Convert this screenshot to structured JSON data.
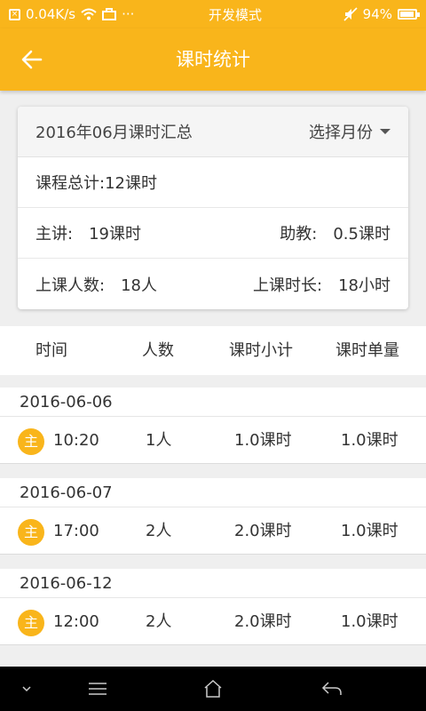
{
  "status_bar": {
    "speed": "0.04K/s",
    "mode": "开发模式",
    "battery": "94%",
    "battery_level": 0.94,
    "dots": "···"
  },
  "app_bar": {
    "title": "课时统计"
  },
  "summary": {
    "title": "2016年06月课时汇总",
    "select_label": "选择月份",
    "total": "课程总计:12课时",
    "lecturer_label": "主讲:",
    "lecturer_value": "19课时",
    "assistant_label": "助教:",
    "assistant_value": "0.5课时",
    "students_label": "上课人数:",
    "students_value": "18人",
    "duration_label": "上课时长:",
    "duration_value": "18小时"
  },
  "table": {
    "headers": [
      "时间",
      "人数",
      "课时小计",
      "课时单量"
    ],
    "groups": [
      {
        "date": "2016-06-06",
        "badge": "主",
        "time": "10:20",
        "people": "1人",
        "subtotal": "1.0课时",
        "unit": "1.0课时"
      },
      {
        "date": "2016-06-07",
        "badge": "主",
        "time": "17:00",
        "people": "2人",
        "subtotal": "2.0课时",
        "unit": "1.0课时"
      },
      {
        "date": "2016-06-12",
        "badge": "主",
        "time": "12:00",
        "people": "2人",
        "subtotal": "2.0课时",
        "unit": "1.0课时"
      }
    ]
  },
  "nav_bar": {
    "icons": [
      "chevron-down-icon",
      "menu-icon",
      "home-icon",
      "back-icon"
    ]
  },
  "colors": {
    "accent": "#f9b51b",
    "background": "#efefef"
  }
}
